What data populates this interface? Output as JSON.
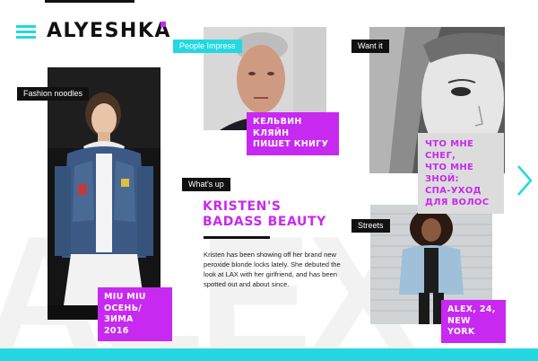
{
  "brand": {
    "logo": "ALYESHKA",
    "watermark": "ALEX",
    "accent_color": "#c729f0",
    "cyan_color": "#23d8e0"
  },
  "nav": {
    "menu_icon": "hamburger-icon",
    "next_icon": "chevron-right-icon"
  },
  "cards": {
    "fashion": {
      "tag": "Fashion noodles",
      "caption": "MIU MIU\nОСЕНЬ/ЗИМА\n2016"
    },
    "people": {
      "tag": "People Impress",
      "caption": "КЕЛЬВИН КЛЯЙН\nПИШЕТ КНИГУ"
    },
    "want": {
      "tag": "Want it",
      "caption": "ЧТО МНЕ СНЕГ,\nЧТО МНЕ ЗНОЙ:\nСПА-УХОД\nДЛЯ ВОЛОС"
    },
    "whats_up": {
      "tag": "What's up",
      "title": "KRISTEN'S\nBADASS BEAUTY",
      "body": "Kristen has been showing off her brand new peroxide blonde locks lately. She debuted the look at LAX with her girlfriend, and has been spotted out and about since."
    },
    "streets": {
      "tag": "Streets",
      "caption": "ALEX, 24,\nNEW YORK"
    }
  }
}
